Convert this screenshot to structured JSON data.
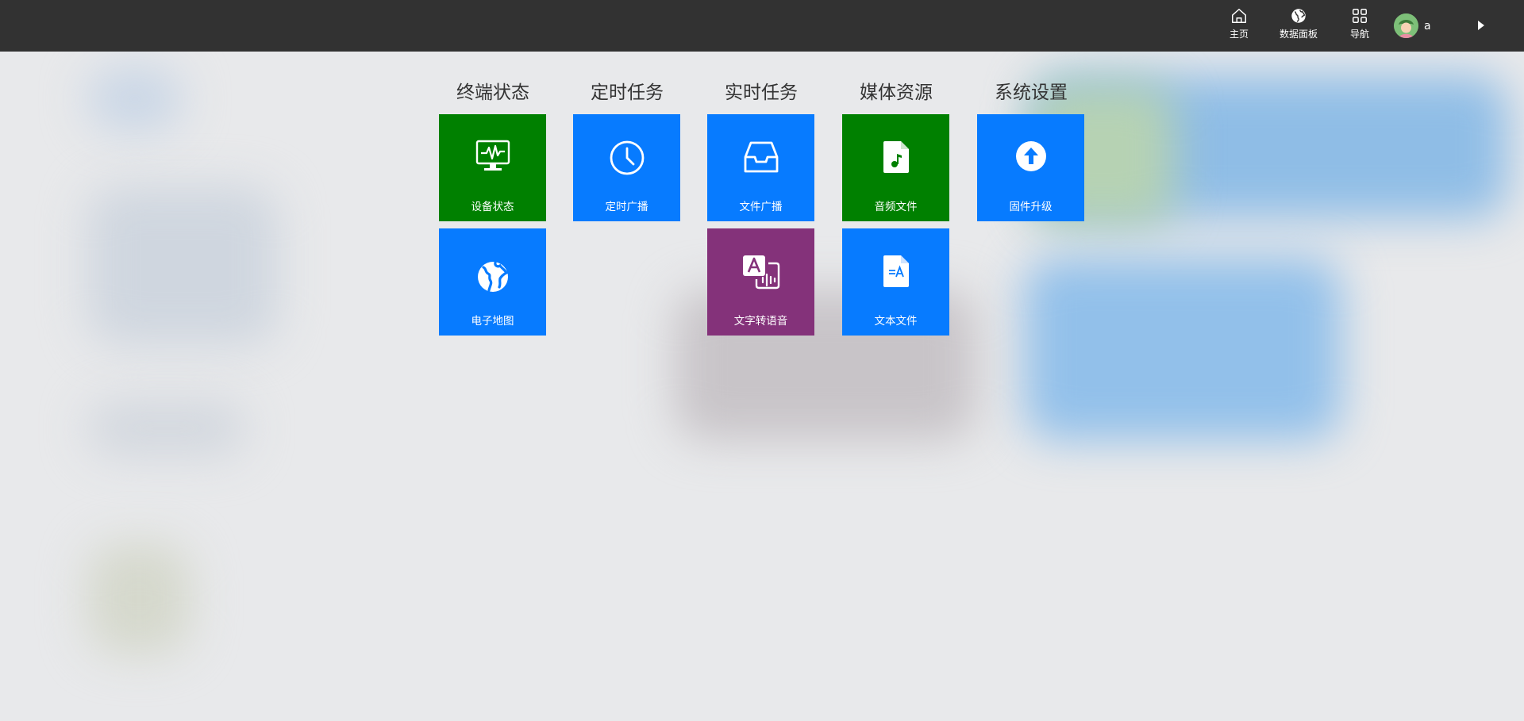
{
  "colors": {
    "topbar": "#323232",
    "green": "#008000",
    "blue": "#077bff",
    "purple": "#84327a",
    "background": "#e8e9eb"
  },
  "header": {
    "nav": [
      {
        "label": "主页",
        "icon": "home-icon"
      },
      {
        "label": "数据面板",
        "icon": "globe-icon"
      },
      {
        "label": "导航",
        "icon": "grid-icon"
      }
    ],
    "user": {
      "name": "a",
      "avatar": "avatar-icon"
    },
    "menu_toggle_icon": "caret-right-icon"
  },
  "columns": [
    {
      "title": "终端状态"
    },
    {
      "title": "定时任务"
    },
    {
      "title": "实时任务"
    },
    {
      "title": "媒体资源"
    },
    {
      "title": "系统设置"
    }
  ],
  "tiles": {
    "device_status": {
      "label": "设备状态",
      "icon": "monitor-pulse-icon",
      "color": "#008000"
    },
    "scheduled_broadcast": {
      "label": "定时广播",
      "icon": "clock-icon",
      "color": "#077bff"
    },
    "file_broadcast": {
      "label": "文件广播",
      "icon": "inbox-icon",
      "color": "#077bff"
    },
    "audio_files": {
      "label": "音频文件",
      "icon": "music-file-icon",
      "color": "#008000"
    },
    "firmware_upgrade": {
      "label": "固件升级",
      "icon": "upload-circle-icon",
      "color": "#077bff"
    },
    "electronic_map": {
      "label": "电子地图",
      "icon": "globe-icon",
      "color": "#077bff"
    },
    "text_to_speech": {
      "label": "文字转语音",
      "icon": "text-to-speech-icon",
      "color": "#84327a"
    },
    "text_files": {
      "label": "文本文件",
      "icon": "text-file-icon",
      "color": "#077bff"
    }
  }
}
